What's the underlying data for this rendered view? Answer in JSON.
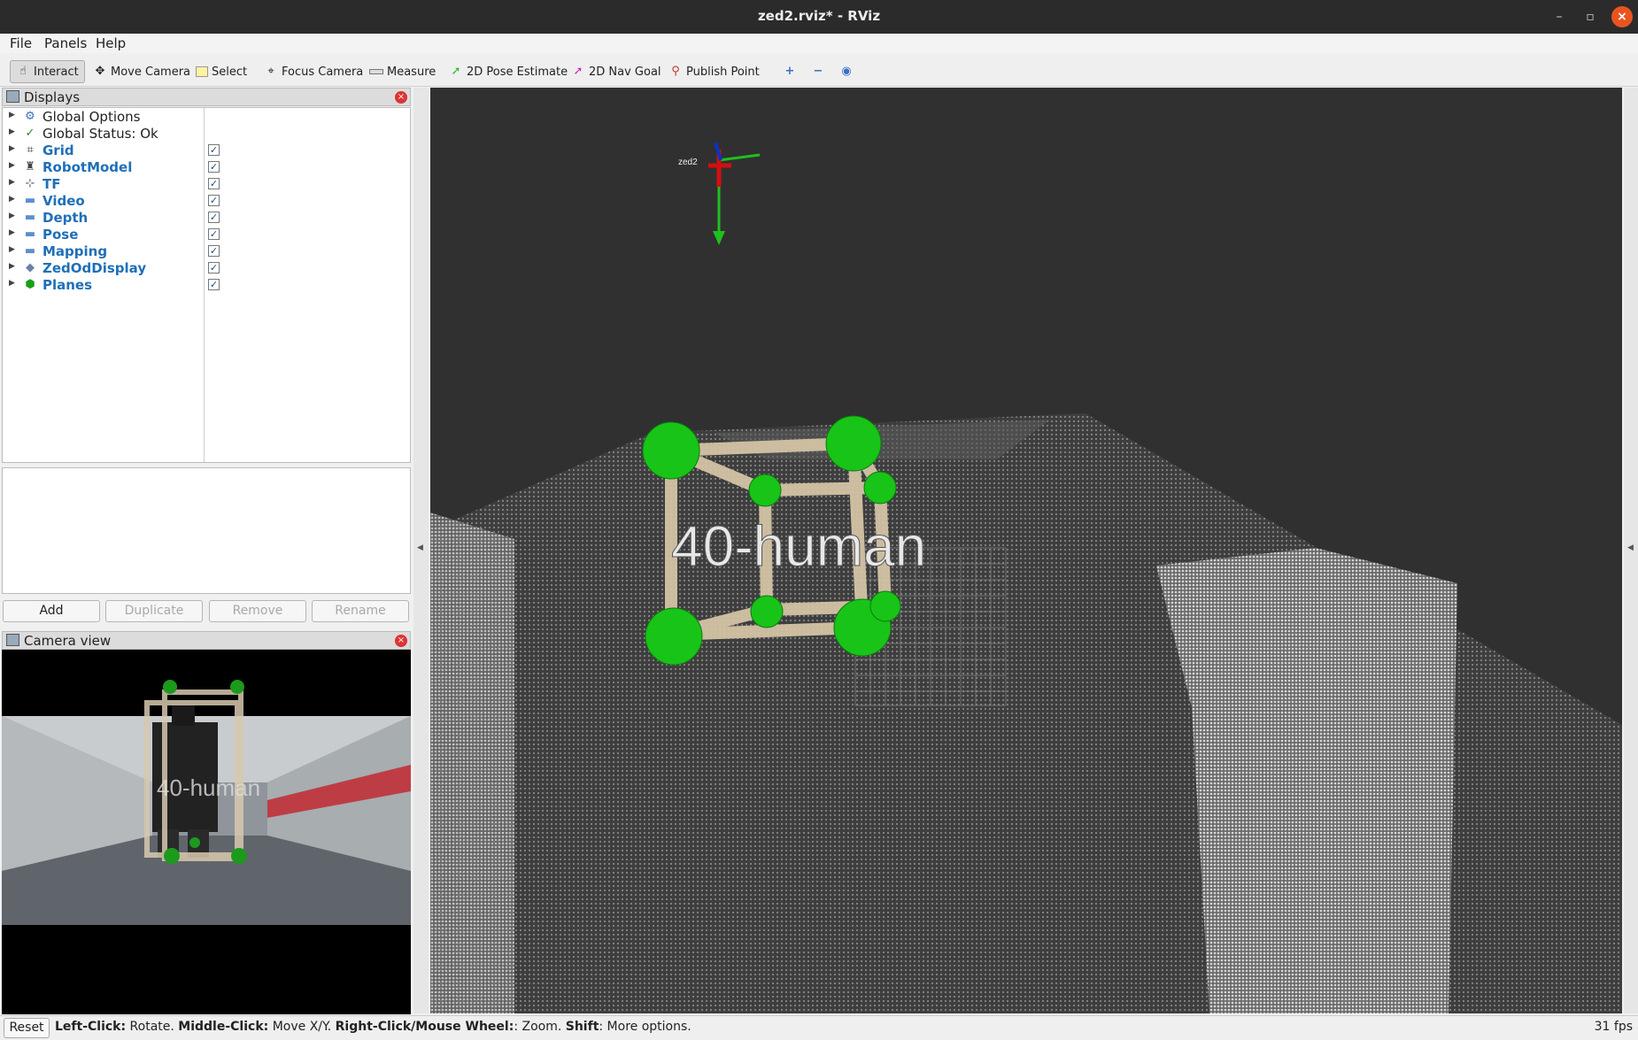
{
  "window": {
    "title": "zed2.rviz* - RViz"
  },
  "menu": {
    "file": "File",
    "panels": "Panels",
    "help": "Help"
  },
  "toolbar": {
    "interact": "Interact",
    "move_camera": "Move Camera",
    "select": "Select",
    "focus_camera": "Focus Camera",
    "measure": "Measure",
    "pose_estimate": "2D Pose Estimate",
    "nav_goal": "2D Nav Goal",
    "publish_point": "Publish Point"
  },
  "displays_panel": {
    "title": "Displays",
    "items": [
      {
        "label": "Global Options",
        "icon": "gear-icon",
        "checkbox": false
      },
      {
        "label": "Global Status: Ok",
        "icon": "check-icon",
        "checkbox": false
      },
      {
        "label": "Grid",
        "icon": "grid-icon",
        "checkbox": true
      },
      {
        "label": "RobotModel",
        "icon": "robot-icon",
        "checkbox": true
      },
      {
        "label": "TF",
        "icon": "axes-icon",
        "checkbox": true
      },
      {
        "label": "Video",
        "icon": "folder-icon",
        "checkbox": true
      },
      {
        "label": "Depth",
        "icon": "folder-icon",
        "checkbox": true
      },
      {
        "label": "Pose",
        "icon": "folder-icon",
        "checkbox": true
      },
      {
        "label": "Mapping",
        "icon": "folder-icon",
        "checkbox": true
      },
      {
        "label": "ZedOdDisplay",
        "icon": "diamond-icon",
        "checkbox": true
      },
      {
        "label": "Planes",
        "icon": "cube-icon",
        "checkbox": true
      }
    ],
    "buttons": {
      "add": "Add",
      "duplicate": "Duplicate",
      "remove": "Remove",
      "rename": "Rename"
    }
  },
  "camera_panel": {
    "title": "Camera view",
    "overlay_label": "40-human"
  },
  "scene": {
    "object_label": "40-human",
    "frame_label": "zed2"
  },
  "statusbar": {
    "reset": "Reset",
    "lc": "Left-Click:",
    "lc_t": " Rotate. ",
    "mc": "Middle-Click:",
    "mc_t": " Move X/Y. ",
    "rc": "Right-Click/Mouse Wheel:",
    "rc_t": ": Zoom. ",
    "sh": "Shift",
    "sh_t": ": More options.",
    "fps": "31 fps"
  }
}
